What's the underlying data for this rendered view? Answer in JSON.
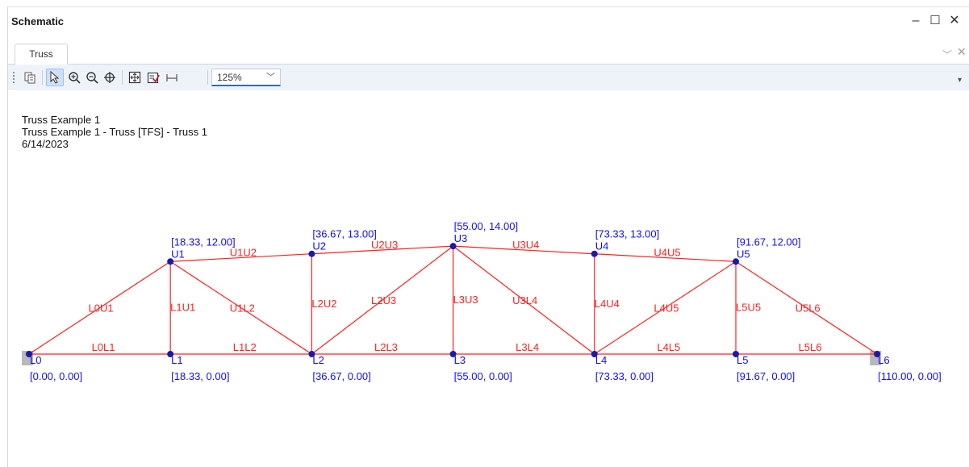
{
  "window": {
    "title": "Schematic",
    "minimize_glyph": "–",
    "maximize_glyph": "☐",
    "close_glyph": "✕"
  },
  "tabs": [
    {
      "label": "Truss",
      "active": true
    }
  ],
  "toolbar": {
    "buttons": [
      "copy-icon",
      "select-pointer-icon",
      "zoom-in-icon",
      "zoom-out-icon",
      "pan-icon",
      "fit-to-window-icon",
      "show-labels-icon",
      "dimensions-icon"
    ],
    "zoom_value": "125%"
  },
  "drawing": {
    "header_lines": [
      "Truss Example 1",
      "Truss Example 1 - Truss [TFS] - Truss 1",
      "6/14/2023"
    ],
    "member_color": "#ff2020",
    "node_label_color": "#1010ee",
    "nodes": [
      {
        "id": "L0",
        "coord": "[0.00, 0.00]",
        "x": 0.0,
        "y": 0.0,
        "support": true
      },
      {
        "id": "L1",
        "coord": "[18.33, 0.00]",
        "x": 18.33,
        "y": 0.0
      },
      {
        "id": "L2",
        "coord": "[36.67, 0.00]",
        "x": 36.67,
        "y": 0.0
      },
      {
        "id": "L3",
        "coord": "[55.00, 0.00]",
        "x": 55.0,
        "y": 0.0
      },
      {
        "id": "L4",
        "coord": "[73.33, 0.00]",
        "x": 73.33,
        "y": 0.0
      },
      {
        "id": "L5",
        "coord": "[91.67, 0.00]",
        "x": 91.67,
        "y": 0.0
      },
      {
        "id": "L6",
        "coord": "[110.00, 0.00]",
        "x": 110.0,
        "y": 0.0,
        "support": true
      },
      {
        "id": "U1",
        "coord": "[18.33, 12.00]",
        "x": 18.33,
        "y": 12.0
      },
      {
        "id": "U2",
        "coord": "[36.67, 13.00]",
        "x": 36.67,
        "y": 13.0
      },
      {
        "id": "U3",
        "coord": "[55.00, 14.00]",
        "x": 55.0,
        "y": 14.0
      },
      {
        "id": "U4",
        "coord": "[73.33, 13.00]",
        "x": 73.33,
        "y": 13.0
      },
      {
        "id": "U5",
        "coord": "[91.67, 12.00]",
        "x": 91.67,
        "y": 12.0
      }
    ],
    "members": [
      {
        "name": "L0L1",
        "from": "L0",
        "to": "L1"
      },
      {
        "name": "L1L2",
        "from": "L1",
        "to": "L2"
      },
      {
        "name": "L2L3",
        "from": "L2",
        "to": "L3"
      },
      {
        "name": "L3L4",
        "from": "L3",
        "to": "L4"
      },
      {
        "name": "L4L5",
        "from": "L4",
        "to": "L5"
      },
      {
        "name": "L5L6",
        "from": "L5",
        "to": "L6"
      },
      {
        "name": "L0U1",
        "from": "L0",
        "to": "U1"
      },
      {
        "name": "U1U2",
        "from": "U1",
        "to": "U2"
      },
      {
        "name": "U2U3",
        "from": "U2",
        "to": "U3"
      },
      {
        "name": "U3U4",
        "from": "U3",
        "to": "U4"
      },
      {
        "name": "U4U5",
        "from": "U4",
        "to": "U5"
      },
      {
        "name": "U5L6",
        "from": "U5",
        "to": "L6"
      },
      {
        "name": "L1U1",
        "from": "L1",
        "to": "U1"
      },
      {
        "name": "U1L2",
        "from": "U1",
        "to": "L2"
      },
      {
        "name": "L2U2",
        "from": "L2",
        "to": "U2"
      },
      {
        "name": "L2U3",
        "from": "L2",
        "to": "U3"
      },
      {
        "name": "L3U3",
        "from": "L3",
        "to": "U3"
      },
      {
        "name": "U3L4",
        "from": "U3",
        "to": "L4"
      },
      {
        "name": "L4U4",
        "from": "L4",
        "to": "U4"
      },
      {
        "name": "L4U5",
        "from": "L4",
        "to": "U5"
      },
      {
        "name": "L5U5",
        "from": "L5",
        "to": "U5"
      }
    ]
  }
}
